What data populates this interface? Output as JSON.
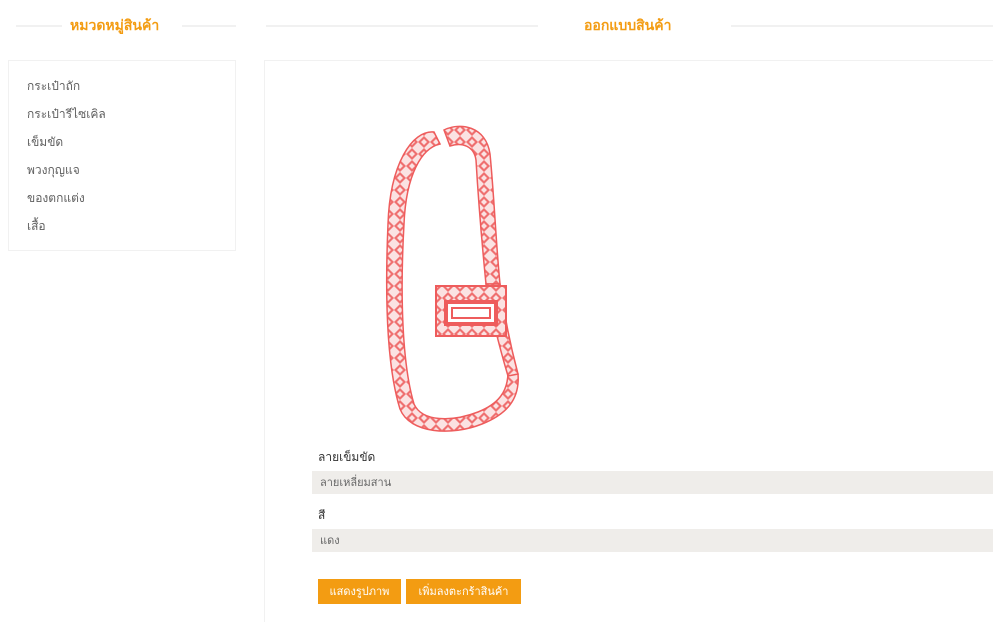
{
  "sidebar": {
    "title": "หมวดหมู่สินค้า",
    "categories": [
      "กระเป๋าถัก",
      "กระเป๋ารีไซเคิล",
      "เข็มขัด",
      "พวงกุญแจ",
      "ของตกแต่ง",
      "เสื้อ"
    ]
  },
  "main": {
    "title": "ออกแบบสินค้า",
    "pattern_label": "ลายเข็มขัด",
    "pattern_value": "ลายเหลี่ยมสาน",
    "color_label": "สี",
    "color_value": "แดง",
    "show_image_button": "แสดงรูปภาพ",
    "add_to_cart_button": "เพิ่มลงตะกร้าสินค้า"
  },
  "colors": {
    "accent": "#f39c12",
    "field_bg": "#efedea",
    "belt": "#ee5c5c"
  }
}
